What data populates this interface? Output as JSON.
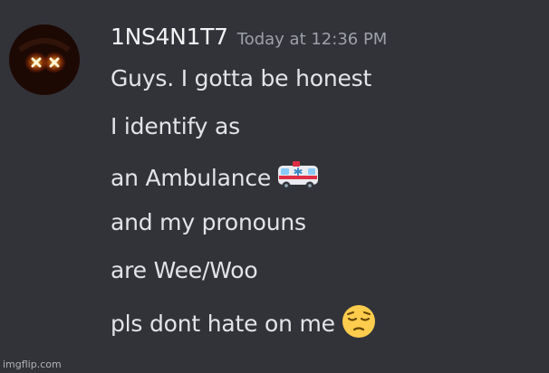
{
  "message": {
    "author": {
      "username": "1NS4N1T7",
      "avatar": "avatar-glowing-x-eyes"
    },
    "timestamp": "Today at 12:36 PM",
    "lines": [
      "Guys. I gotta be honest",
      "I identify as",
      "an Ambulance",
      "and my pronouns",
      "are Wee/Woo",
      "pls dont hate on me"
    ],
    "inline_emojis": {
      "line_3": "ambulance-emoji",
      "line_6": "pensive-face-emoji"
    }
  },
  "watermark": "imgflip.com",
  "colors": {
    "background": "#323339",
    "username": "#f2f3f5",
    "timestamp": "#9ea1a8",
    "text": "#e3e4e7"
  }
}
